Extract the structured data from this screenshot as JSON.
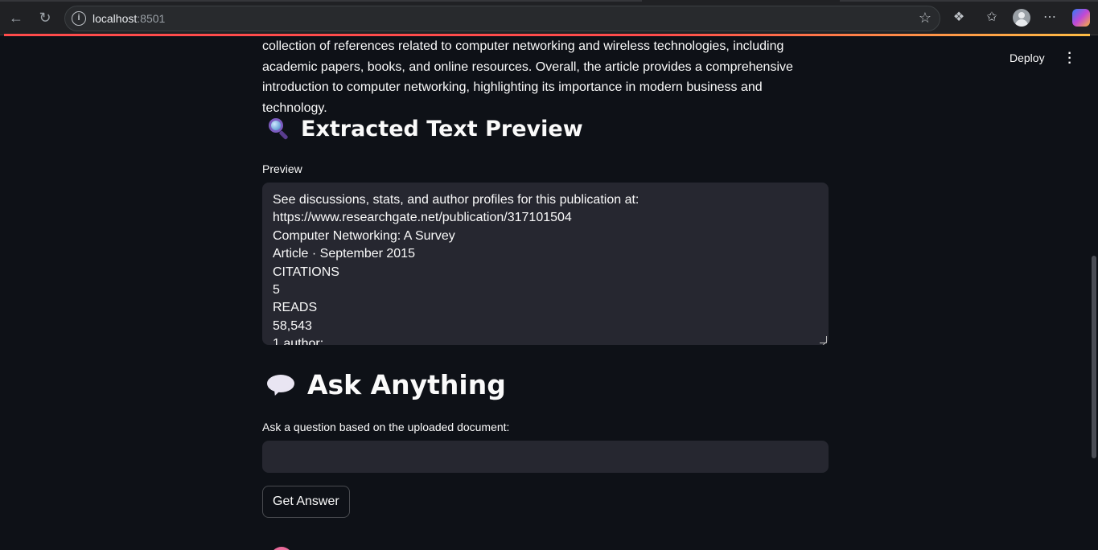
{
  "browser": {
    "url_host": "localhost",
    "url_port": ":8501"
  },
  "app": {
    "deploy_label": "Deploy"
  },
  "summary": {
    "text": "collection of references related to computer networking and wireless technologies, including academic papers, books, and online resources. Overall, the article provides a comprehensive introduction to computer networking, highlighting its importance in modern business and technology."
  },
  "extracted": {
    "heading": "Extracted Text Preview",
    "label": "Preview",
    "lines": [
      "See discussions, stats, and author profiles for this publication at:",
      "https://www.researchgate.net/publication/317101504",
      "Computer Networking: A Survey",
      "Article · September 2015",
      "CITATIONS",
      "5",
      "READS",
      "58,543",
      "1 author:"
    ]
  },
  "ask": {
    "heading": "Ask Anything",
    "label": "Ask a question based on the uploaded document:",
    "input_value": "",
    "button_label": "Get Answer"
  },
  "colors": {
    "background": "#0e1117",
    "input_bg": "#262730",
    "accent": "#ff4b4b"
  }
}
